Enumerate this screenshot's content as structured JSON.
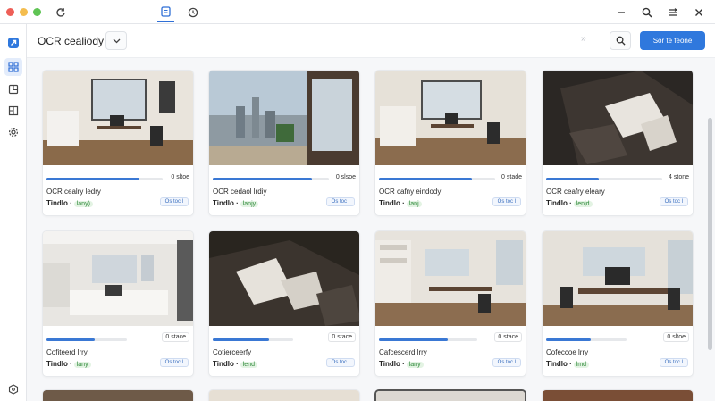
{
  "header": {
    "title": "OCR cealiody",
    "primary_button": "Sor te feone",
    "arrows": "››"
  },
  "cards": [
    {
      "title": "OCR cealry ledry",
      "meta": "Tindlo ·",
      "tag": "lany)",
      "badge": "0 sltoe",
      "badge_boxed": false,
      "pill": "Os toc l",
      "progress": 0.8
    },
    {
      "title": "OCR cedaol lrdiy",
      "meta": "Tindlo ·",
      "tag": "lanjy",
      "badge": "0 slsoe",
      "badge_boxed": false,
      "pill": "Os toc l",
      "progress": 0.85
    },
    {
      "title": "OCR cafny eindody",
      "meta": "Tindlo ·",
      "tag": "lanj",
      "badge": "0 stade",
      "badge_boxed": false,
      "pill": "Os toc l",
      "progress": 0.8
    },
    {
      "title": "OCR ceafry eleary",
      "meta": "Tindlo ·",
      "tag": "lenjd",
      "badge": "4 stone",
      "badge_boxed": false,
      "pill": "Os toc l",
      "progress": 0.45
    },
    {
      "title": "Cofiteerd lrry",
      "meta": "Tindlo ·",
      "tag": "lany",
      "badge": "0 stace",
      "badge_boxed": true,
      "pill": "Os toc l",
      "progress": 0.6
    },
    {
      "title": "Cotierceerfy",
      "meta": "Tindlo ·",
      "tag": "lend",
      "badge": "0 stace",
      "badge_boxed": true,
      "pill": "Os toc l",
      "progress": 0.7
    },
    {
      "title": "Cafcescerd lrry",
      "meta": "Tindlo ·",
      "tag": "lany",
      "badge": "0 stace",
      "badge_boxed": true,
      "pill": "Os toc l",
      "progress": 0.7
    },
    {
      "title": "Cofeccoe lrry",
      "meta": "Tindlo ·",
      "tag": "lmd",
      "badge": "0 sltoe",
      "badge_boxed": true,
      "pill": "Os toc l",
      "progress": 0.55
    }
  ],
  "colors": {
    "accent": "#2f78dd",
    "tag_bg": "#e3f3e3",
    "tag_fg": "#2f8a3a"
  }
}
